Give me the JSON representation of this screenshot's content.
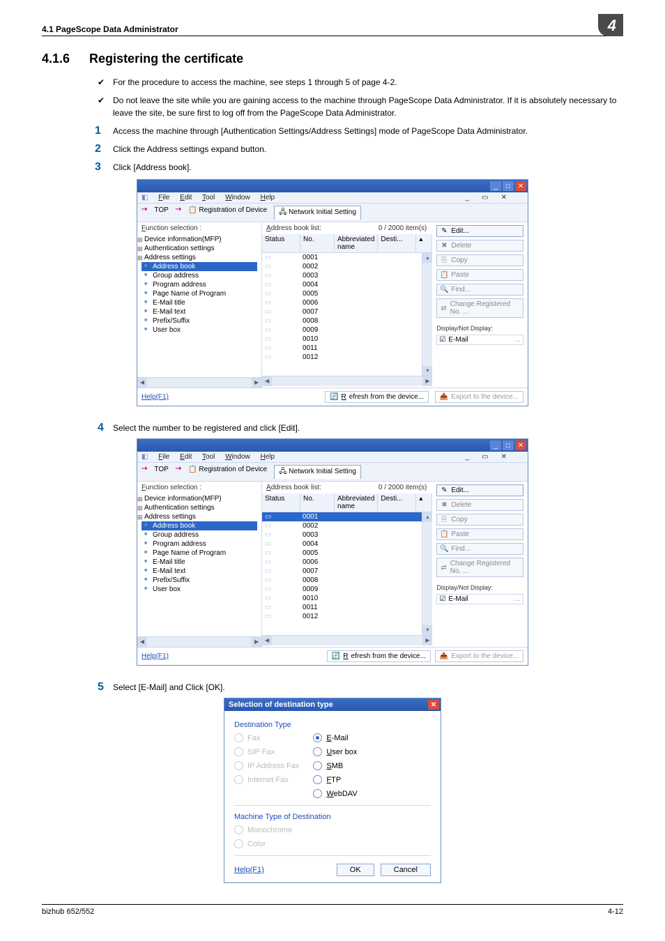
{
  "header": {
    "left": "4.1    PageScope Data Administrator",
    "chapter": "4"
  },
  "section": {
    "number": "4.1.6",
    "title": "Registering the certificate"
  },
  "checks": [
    "For the procedure to access the machine, see steps 1 through 5 of page 4-2.",
    "Do not leave the site while you are gaining access to the machine through PageScope Data Administrator. If it is absolutely necessary to leave the site, be sure first to log off from the PageScope Data Administrator."
  ],
  "steps": [
    "Access the machine through [Authentication Settings/Address Settings] mode of PageScope Data Administrator.",
    "Click the Address settings expand button.",
    "Click [Address book]."
  ],
  "step4": "Select the number to be registered and click [Edit].",
  "step5": "Select [E-Mail] and Click [OK].",
  "app": {
    "menus": {
      "file": "File",
      "edit": "Edit",
      "tool": "Tool",
      "window": "Window",
      "help": "Help"
    },
    "tabs": {
      "top": "TOP",
      "reg": "Registration of Device",
      "net": "Network Initial Setting"
    },
    "left_label": "Function selection :",
    "mid_label": "Address book list:",
    "count": "0 / 2000 item(s)",
    "tree": [
      "Device information(MFP)",
      "Authentication settings",
      "Address settings",
      "Address book",
      "Group address",
      "Program address",
      "Page Name of Program",
      "E-Mail title",
      "E-Mail text",
      "Prefix/Suffix",
      "User box"
    ],
    "tree_sel_index": 3,
    "cols": {
      "status": "Status",
      "no": "No.",
      "abbr": "Abbreviated name",
      "dest": "Desti..."
    },
    "rows": [
      "0001",
      "0002",
      "0003",
      "0004",
      "0005",
      "0006",
      "0007",
      "0008",
      "0009",
      "0010",
      "0011",
      "0012"
    ],
    "row_sel_index_s2": 0,
    "buttons": {
      "edit": "Edit...",
      "delete": "Delete",
      "copy": "Copy",
      "paste": "Paste",
      "find": "Find...",
      "change": "Change Registered No. ..."
    },
    "display_label": "Display/Not Display:",
    "display_check": "E-Mail",
    "help": "Help(F1)",
    "refresh": "Refresh from the device...",
    "export": "Export to the device..."
  },
  "dlg": {
    "title": "Selection of destination type",
    "group1": "Destination Type",
    "left_opts": [
      {
        "l": "Fax",
        "d": true
      },
      {
        "l": "SIP Fax",
        "d": true
      },
      {
        "l": "IP Address Fax",
        "d": true
      },
      {
        "l": "Internet Fax",
        "d": true
      }
    ],
    "right_opts": [
      {
        "l": "E-Mail",
        "sel": true
      },
      {
        "l": "User box"
      },
      {
        "l": "SMB"
      },
      {
        "l": "FTP"
      },
      {
        "l": "WebDAV"
      }
    ],
    "group2": "Machine Type of Destination",
    "g2_opts": [
      {
        "l": "Monochrome",
        "d": true
      },
      {
        "l": "Color",
        "d": true
      }
    ],
    "help": "Help(F1)",
    "ok": "OK",
    "cancel": "Cancel"
  },
  "footer": {
    "left": "bizhub 652/552",
    "right": "4-12"
  }
}
